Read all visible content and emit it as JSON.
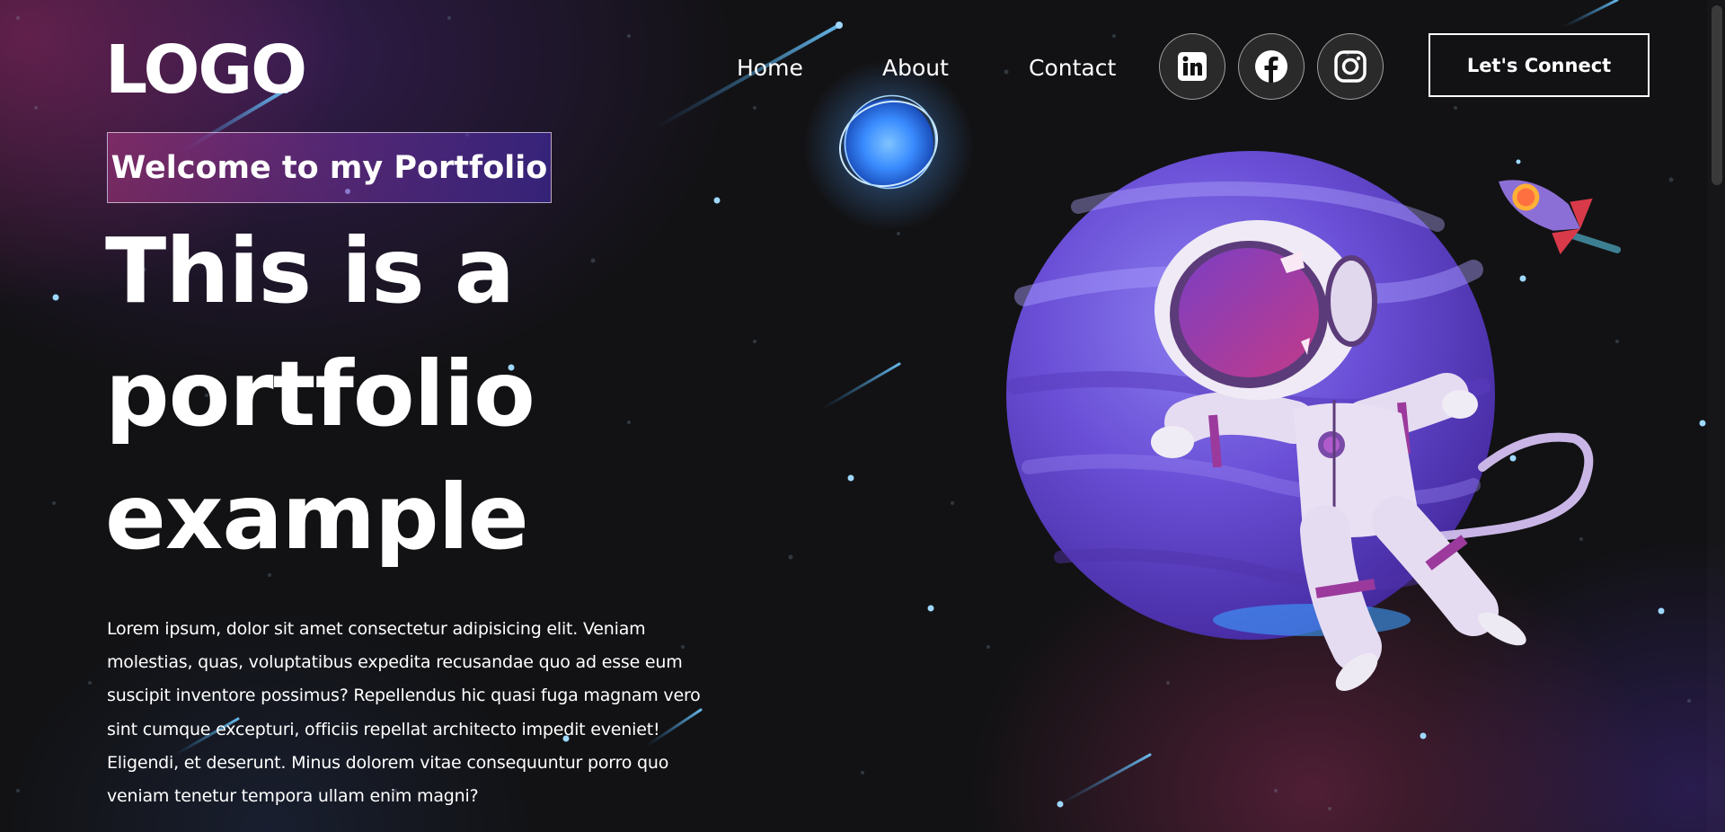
{
  "header": {
    "logo": "LOGO",
    "nav": [
      {
        "label": "Home"
      },
      {
        "label": "About"
      },
      {
        "label": "Contact"
      }
    ],
    "social": [
      "linkedin-icon",
      "facebook-icon",
      "instagram-icon"
    ],
    "cta_label": "Let's Connect"
  },
  "hero": {
    "tagline": "Welcome to my Portfolio",
    "headline_lines": [
      "This is a",
      "portfolio",
      "example"
    ],
    "description": "Lorem ipsum, dolor sit amet consectetur adipisicing elit. Veniam molestias, quas, voluptatibus expedita recusandae quo ad esse eum suscipit inventore possimus? Repellendus hic quasi fuga magnam vero sint cumque excepturi, officiis repellat architecto impedit eveniet! Eligendi, et deserunt. Minus dolorem vitae consequuntur porro quo veniam tenetur tempora ullam enim magni?"
  },
  "colors": {
    "background": "#121212",
    "tagline_gradient_start": "#aa367c",
    "tagline_gradient_end": "#4a2fbd",
    "planet": "#6a4fd6",
    "accent_blue": "#4da6ff"
  }
}
